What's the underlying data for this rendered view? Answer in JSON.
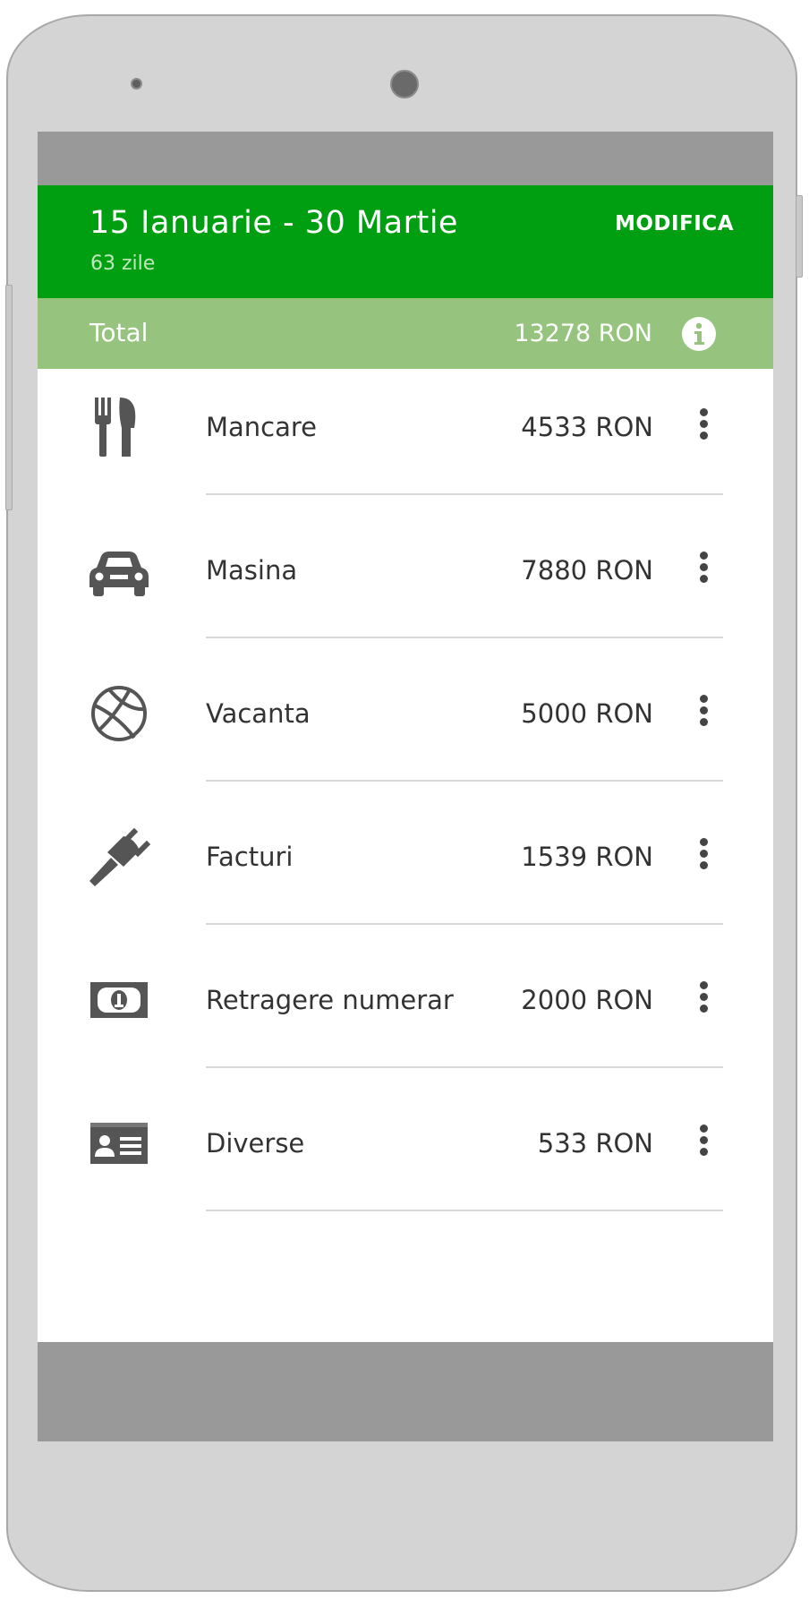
{
  "header": {
    "period": "15 Ianuarie - 30 Martie",
    "days": "63 zile",
    "modify_label": "MODIFICA"
  },
  "total": {
    "label": "Total",
    "amount": "13278 RON",
    "info_icon": "info-icon"
  },
  "categories": [
    {
      "label": "Mancare",
      "amount": "4533 RON",
      "icon": "cutlery-icon"
    },
    {
      "label": "Masina",
      "amount": "7880 RON",
      "icon": "car-icon"
    },
    {
      "label": "Vacanta",
      "amount": "5000 RON",
      "icon": "ball-icon"
    },
    {
      "label": "Facturi",
      "amount": "1539 RON",
      "icon": "plug-icon"
    },
    {
      "label": "Retragere numerar",
      "amount": "2000 RON",
      "icon": "banknote-icon"
    },
    {
      "label": "Diverse",
      "amount": "533 RON",
      "icon": "id-card-icon"
    }
  ],
  "colors": {
    "header_green": "#009f12",
    "total_green": "#96c47f",
    "status_gray": "#999999",
    "device_gray": "#d4d4d4",
    "icon_gray": "#555555"
  }
}
